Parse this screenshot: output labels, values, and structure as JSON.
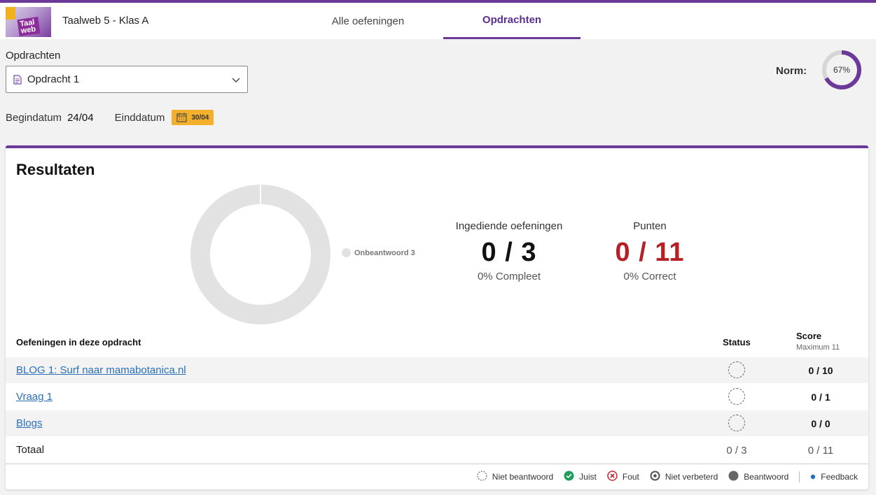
{
  "header": {
    "logo_text": "Taal web",
    "app_title": "Taalweb 5 - Klas A",
    "tabs": [
      {
        "label": "Alle oefeningen",
        "active": false
      },
      {
        "label": "Opdrachten",
        "active": true
      }
    ],
    "accent_color": "#6b3a98"
  },
  "assignment": {
    "section_label": "Opdrachten",
    "selected": "Opdracht 1",
    "icon": "document-icon",
    "start_label": "Begindatum",
    "start_value": "24/04",
    "end_label": "Einddatum",
    "end_value": "30/04"
  },
  "norm": {
    "label": "Norm:",
    "value_text": "67%",
    "value": 0.67
  },
  "results": {
    "title": "Resultaten",
    "chart_legend": "Onbeantwoord 3",
    "chart_data": {
      "type": "pie",
      "categories": [
        "Onbeantwoord"
      ],
      "values": [
        3
      ],
      "colors": [
        "#e2e2e2"
      ]
    },
    "submitted": {
      "title": "Ingediende oefeningen",
      "value": "0 / 3",
      "sub": "0% Compleet",
      "color": "#111111"
    },
    "points": {
      "title": "Punten",
      "value": "0 / 11",
      "sub": "0% Correct",
      "color": "#b61f24"
    }
  },
  "table": {
    "col_name": "Oefeningen in deze opdracht",
    "col_status": "Status",
    "col_score": "Score",
    "col_score_sub": "Maximum 11",
    "rows": [
      {
        "name": "BLOG 1: Surf naar mamabotanica.nl",
        "status": "niet-beantwoord",
        "score": "0 / 10"
      },
      {
        "name": "Vraag 1",
        "status": "niet-beantwoord",
        "score": "0 / 1"
      },
      {
        "name": "Blogs",
        "status": "niet-beantwoord",
        "score": "0 / 0"
      }
    ],
    "total": {
      "label": "Totaal",
      "status": "0 / 3",
      "score": "0 / 11"
    }
  },
  "legend": {
    "items": [
      {
        "label": "Niet beantwoord",
        "icon": "dashed-circle-icon"
      },
      {
        "label": "Juist",
        "icon": "check-circle-icon",
        "color": "#1e9e5a"
      },
      {
        "label": "Fout",
        "icon": "x-circle-icon",
        "color": "#c9252c"
      },
      {
        "label": "Niet verbeterd",
        "icon": "ring-icon",
        "color": "#555555"
      },
      {
        "label": "Beantwoord",
        "icon": "filled-circle-icon",
        "color": "#666666"
      },
      {
        "label": "Feedback",
        "icon": "dot-icon",
        "color": "#2a6fb7"
      }
    ]
  }
}
